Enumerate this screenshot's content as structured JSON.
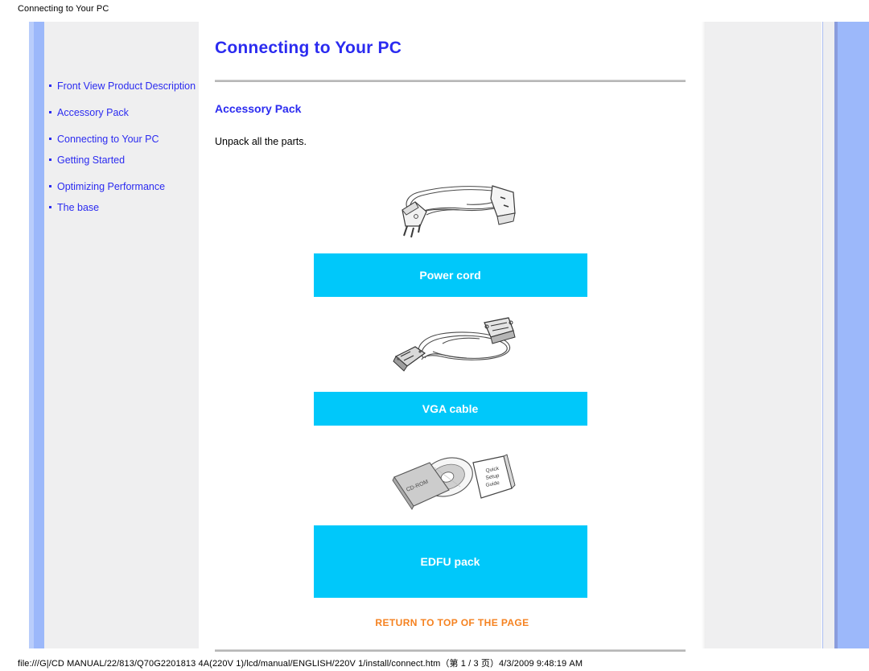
{
  "print": {
    "header_title": "Connecting to Your PC",
    "footer_path": "file:///G|/CD MANUAL/22/813/Q70G2201813 4A(220V 1)/lcd/manual/ENGLISH/220V 1/install/connect.htm（第 1 / 3 页）4/3/2009 9:48:19 AM"
  },
  "sidebar": {
    "items": [
      {
        "label": "Front View Product Description"
      },
      {
        "label": "Accessory Pack"
      },
      {
        "label": "Connecting to Your PC"
      },
      {
        "label": "Getting Started"
      },
      {
        "label": "Optimizing Performance"
      },
      {
        "label": "The base"
      }
    ]
  },
  "main": {
    "title": "Connecting to Your PC",
    "section_title": "Accessory Pack",
    "intro": "Unpack all the parts.",
    "accessories": [
      {
        "caption": "Power cord",
        "figure": "power-cord"
      },
      {
        "caption": "VGA cable",
        "figure": "vga-cable"
      },
      {
        "caption": "EDFU pack",
        "figure": "edfu-pack"
      }
    ],
    "cd_label": "CD-ROM",
    "booklet_label": "Quick Setup Guide",
    "return_link": "RETURN TO TOP OF THE PAGE"
  },
  "colors": {
    "accent_cyan": "#00C8FA",
    "link_blue": "#2B2BF0",
    "return_orange": "#F58220",
    "edge_blue": "#9CB8FA",
    "panel_gray": "#EFEFF0"
  }
}
